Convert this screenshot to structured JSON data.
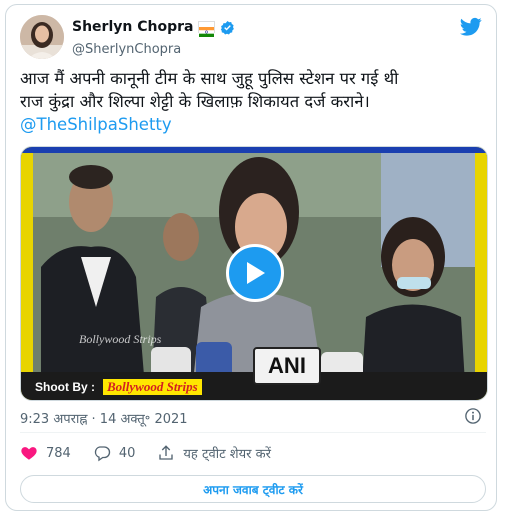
{
  "author": {
    "display_name": "Sherlyn Chopra",
    "handle": "@SherlynChopra",
    "flag_icon": "india-flag-icon",
    "verified_icon": "verified-badge-icon",
    "avatar_icon": "profile-avatar"
  },
  "tweet": {
    "text_line1": "आज मैं अपनी कानूनी टीम के साथ जुहू पुलिस स्टेशन पर गई थी",
    "text_line2": "राज कुंद्रा और शिल्पा शेट्टी के खिलाफ़ शिकायत दर्ज कराने।",
    "mention": "@TheShilpaShetty",
    "timestamp": "9:23 अपराह्न · 14 अक्तू॰ 2021"
  },
  "media": {
    "shoot_by_label": "Shoot By :",
    "credit": "Bollywood Strips",
    "watermark": "Bollywood Strips",
    "mic_label": "ANI",
    "play_icon": "play-icon"
  },
  "actions": {
    "likes": "784",
    "replies": "40",
    "share_label": "यह ट्वीट शेयर करें"
  },
  "reply_button_label": "अपना जवाब ट्वीट करें",
  "colors": {
    "accent": "#1d9bf0",
    "like": "#f91880",
    "text": "#0f1419",
    "muted": "#536471"
  }
}
